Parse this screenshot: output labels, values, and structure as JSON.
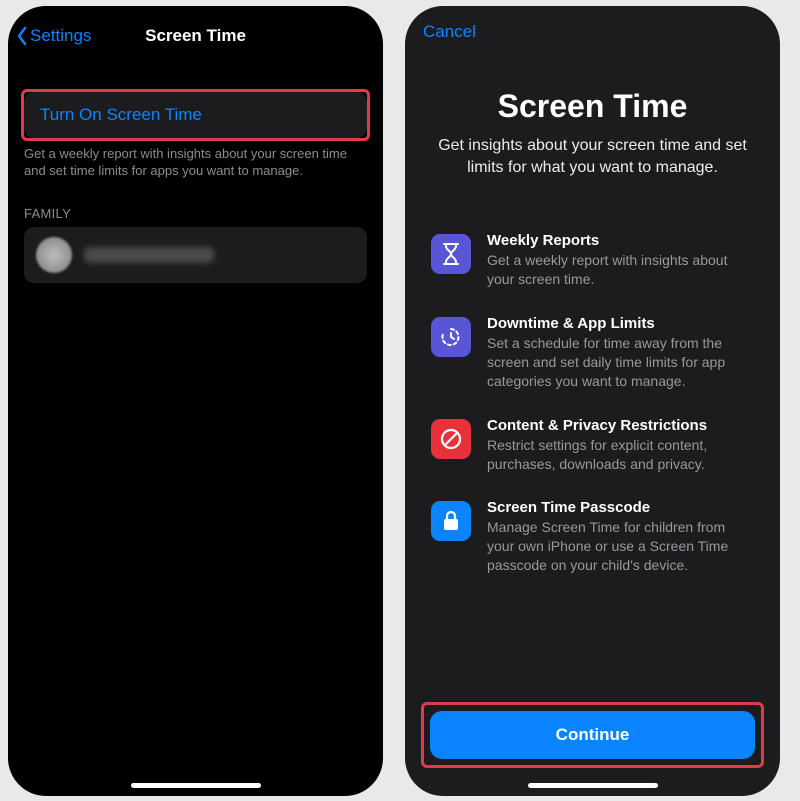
{
  "left": {
    "back": "Settings",
    "title": "Screen Time",
    "turn_on": "Turn On Screen Time",
    "footer": "Get a weekly report with insights about your screen time and set time limits for apps you want to manage.",
    "family_header": "FAMILY"
  },
  "right": {
    "cancel": "Cancel",
    "title": "Screen Time",
    "subtitle": "Get insights about your screen time and set limits for what you want to manage.",
    "features": [
      {
        "title": "Weekly Reports",
        "desc": "Get a weekly report with insights about your screen time."
      },
      {
        "title": "Downtime & App Limits",
        "desc": "Set a schedule for time away from the screen and set daily time limits for app categories you want to manage."
      },
      {
        "title": "Content & Privacy Restrictions",
        "desc": "Restrict settings for explicit content, purchases, downloads and privacy."
      },
      {
        "title": "Screen Time Passcode",
        "desc": "Manage Screen Time for children from your own iPhone or use a Screen Time passcode on your child's device."
      }
    ],
    "continue": "Continue"
  }
}
